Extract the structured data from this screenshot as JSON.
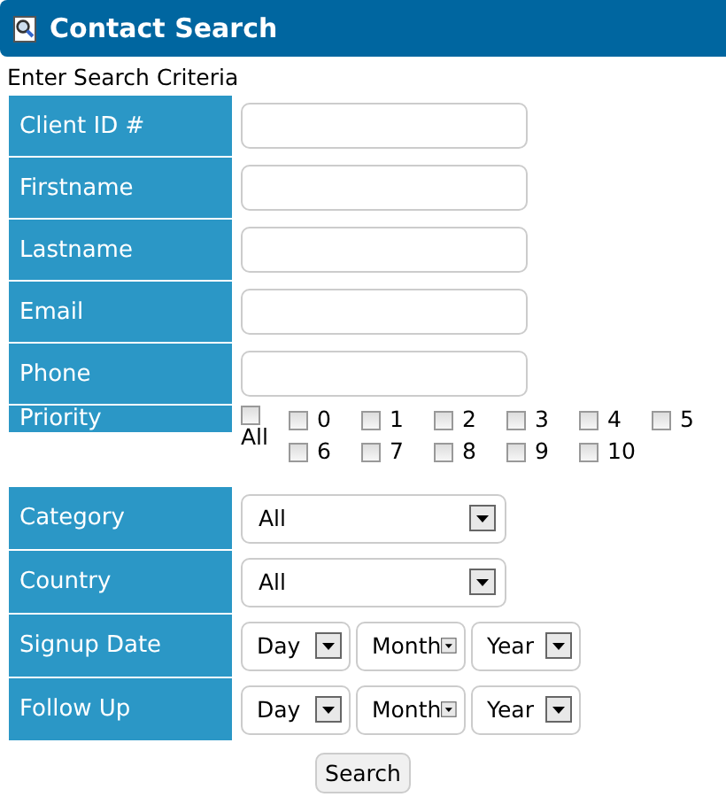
{
  "header": {
    "title": "Contact Search"
  },
  "subtitle": "Enter Search Criteria",
  "fields": [
    {
      "kind": "text",
      "label": "Client ID #"
    },
    {
      "kind": "text",
      "label": "Firstname"
    },
    {
      "kind": "text",
      "label": "Lastname"
    },
    {
      "kind": "text",
      "label": "Email"
    },
    {
      "kind": "text",
      "label": "Phone"
    },
    {
      "kind": "checks",
      "label": "Priority",
      "all": {
        "label": "All",
        "checked": false
      },
      "options": [
        {
          "label": "0",
          "checked": false
        },
        {
          "label": "1",
          "checked": false
        },
        {
          "label": "2",
          "checked": false
        },
        {
          "label": "3",
          "checked": false
        },
        {
          "label": "4",
          "checked": false
        },
        {
          "label": "5",
          "checked": false
        },
        {
          "label": "6",
          "checked": false
        },
        {
          "label": "7",
          "checked": false
        },
        {
          "label": "8",
          "checked": false
        },
        {
          "label": "9",
          "checked": false
        },
        {
          "label": "10",
          "checked": false
        }
      ]
    },
    {
      "kind": "select",
      "label": "Category",
      "value": "All"
    },
    {
      "kind": "select",
      "label": "Country",
      "value": "All"
    },
    {
      "kind": "date",
      "label": "Signup Date",
      "parts": [
        "Day",
        "Month",
        "Year"
      ]
    },
    {
      "kind": "date",
      "label": "Follow Up",
      "parts": [
        "Day",
        "Month",
        "Year"
      ]
    }
  ],
  "button": "Search"
}
